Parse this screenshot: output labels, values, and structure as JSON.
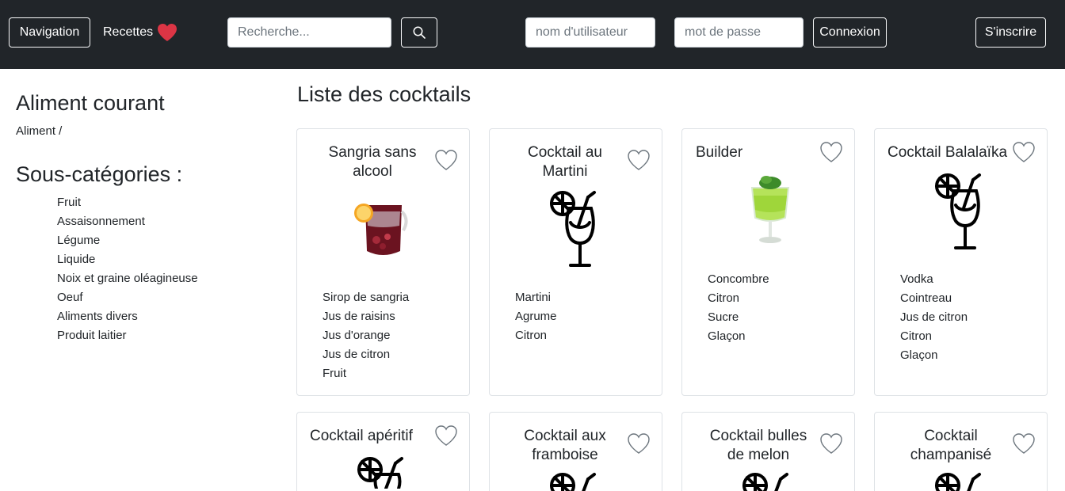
{
  "navbar": {
    "nav_button": "Navigation",
    "recipes_link": "Recettes",
    "search_placeholder": "Recherche...",
    "username_placeholder": "nom d'utilisateur",
    "password_placeholder": "mot de passe",
    "login_button": "Connexion",
    "signup_button": "S'inscrire"
  },
  "sidebar": {
    "current_title": "Aliment courant",
    "breadcrumb": "Aliment /",
    "subcats_title": "Sous-catégories :",
    "subcategories": [
      "Fruit",
      "Assaisonnement",
      "Légume",
      "Liquide",
      "Noix et graine oléagineuse",
      "Oeuf",
      "Aliments divers",
      "Produit laitier"
    ]
  },
  "main": {
    "title": "Liste des cocktails",
    "cards": [
      {
        "title_l1": "Sangria sans",
        "title_l2": "alcool",
        "image": "sangria-photo",
        "ingredients": [
          "Sirop de sangria",
          "Jus de raisins",
          "Jus d'orange",
          "Jus de citron",
          "Fruit"
        ]
      },
      {
        "title_l1": "Cocktail au",
        "title_l2": "Martini",
        "image": "cocktail-glass-icon",
        "ingredients": [
          "Martini",
          "Agrume",
          "Citron"
        ]
      },
      {
        "title_l1": "Builder",
        "title_l2": "",
        "image": "green-cocktail-photo",
        "ingredients": [
          "Concombre",
          "Citron",
          "Sucre",
          "Glaçon"
        ]
      },
      {
        "title_l1": "Cocktail Balalaïka",
        "title_l2": "",
        "image": "cocktail-glass-icon",
        "ingredients": [
          "Vodka",
          "Cointreau",
          "Jus de citron",
          "Citron",
          "Glaçon"
        ]
      },
      {
        "title_l1": "Cocktail apéritif",
        "title_l2": "",
        "image": "cocktail-glass-icon",
        "ingredients": []
      },
      {
        "title_l1": "Cocktail aux",
        "title_l2": "framboise",
        "image": "cocktail-glass-icon",
        "ingredients": []
      },
      {
        "title_l1": "Cocktail bulles",
        "title_l2": "de melon",
        "image": "cocktail-glass-icon",
        "ingredients": []
      },
      {
        "title_l1": "Cocktail",
        "title_l2": "champanisé",
        "image": "cocktail-glass-icon",
        "ingredients": []
      }
    ]
  },
  "colors": {
    "navbar_bg": "#212529",
    "heart_red": "#dc3545",
    "card_border": "#dee2e6"
  }
}
